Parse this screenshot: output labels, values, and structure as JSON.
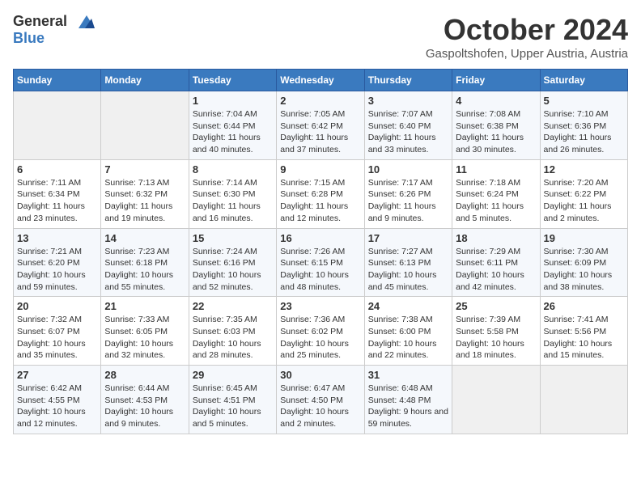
{
  "header": {
    "logo_general": "General",
    "logo_blue": "Blue",
    "month_title": "October 2024",
    "location": "Gaspoltshofen, Upper Austria, Austria"
  },
  "calendar": {
    "days_of_week": [
      "Sunday",
      "Monday",
      "Tuesday",
      "Wednesday",
      "Thursday",
      "Friday",
      "Saturday"
    ],
    "weeks": [
      [
        {
          "day": "",
          "info": ""
        },
        {
          "day": "",
          "info": ""
        },
        {
          "day": "1",
          "info": "Sunrise: 7:04 AM\nSunset: 6:44 PM\nDaylight: 11 hours and 40 minutes."
        },
        {
          "day": "2",
          "info": "Sunrise: 7:05 AM\nSunset: 6:42 PM\nDaylight: 11 hours and 37 minutes."
        },
        {
          "day": "3",
          "info": "Sunrise: 7:07 AM\nSunset: 6:40 PM\nDaylight: 11 hours and 33 minutes."
        },
        {
          "day": "4",
          "info": "Sunrise: 7:08 AM\nSunset: 6:38 PM\nDaylight: 11 hours and 30 minutes."
        },
        {
          "day": "5",
          "info": "Sunrise: 7:10 AM\nSunset: 6:36 PM\nDaylight: 11 hours and 26 minutes."
        }
      ],
      [
        {
          "day": "6",
          "info": "Sunrise: 7:11 AM\nSunset: 6:34 PM\nDaylight: 11 hours and 23 minutes."
        },
        {
          "day": "7",
          "info": "Sunrise: 7:13 AM\nSunset: 6:32 PM\nDaylight: 11 hours and 19 minutes."
        },
        {
          "day": "8",
          "info": "Sunrise: 7:14 AM\nSunset: 6:30 PM\nDaylight: 11 hours and 16 minutes."
        },
        {
          "day": "9",
          "info": "Sunrise: 7:15 AM\nSunset: 6:28 PM\nDaylight: 11 hours and 12 minutes."
        },
        {
          "day": "10",
          "info": "Sunrise: 7:17 AM\nSunset: 6:26 PM\nDaylight: 11 hours and 9 minutes."
        },
        {
          "day": "11",
          "info": "Sunrise: 7:18 AM\nSunset: 6:24 PM\nDaylight: 11 hours and 5 minutes."
        },
        {
          "day": "12",
          "info": "Sunrise: 7:20 AM\nSunset: 6:22 PM\nDaylight: 11 hours and 2 minutes."
        }
      ],
      [
        {
          "day": "13",
          "info": "Sunrise: 7:21 AM\nSunset: 6:20 PM\nDaylight: 10 hours and 59 minutes."
        },
        {
          "day": "14",
          "info": "Sunrise: 7:23 AM\nSunset: 6:18 PM\nDaylight: 10 hours and 55 minutes."
        },
        {
          "day": "15",
          "info": "Sunrise: 7:24 AM\nSunset: 6:16 PM\nDaylight: 10 hours and 52 minutes."
        },
        {
          "day": "16",
          "info": "Sunrise: 7:26 AM\nSunset: 6:15 PM\nDaylight: 10 hours and 48 minutes."
        },
        {
          "day": "17",
          "info": "Sunrise: 7:27 AM\nSunset: 6:13 PM\nDaylight: 10 hours and 45 minutes."
        },
        {
          "day": "18",
          "info": "Sunrise: 7:29 AM\nSunset: 6:11 PM\nDaylight: 10 hours and 42 minutes."
        },
        {
          "day": "19",
          "info": "Sunrise: 7:30 AM\nSunset: 6:09 PM\nDaylight: 10 hours and 38 minutes."
        }
      ],
      [
        {
          "day": "20",
          "info": "Sunrise: 7:32 AM\nSunset: 6:07 PM\nDaylight: 10 hours and 35 minutes."
        },
        {
          "day": "21",
          "info": "Sunrise: 7:33 AM\nSunset: 6:05 PM\nDaylight: 10 hours and 32 minutes."
        },
        {
          "day": "22",
          "info": "Sunrise: 7:35 AM\nSunset: 6:03 PM\nDaylight: 10 hours and 28 minutes."
        },
        {
          "day": "23",
          "info": "Sunrise: 7:36 AM\nSunset: 6:02 PM\nDaylight: 10 hours and 25 minutes."
        },
        {
          "day": "24",
          "info": "Sunrise: 7:38 AM\nSunset: 6:00 PM\nDaylight: 10 hours and 22 minutes."
        },
        {
          "day": "25",
          "info": "Sunrise: 7:39 AM\nSunset: 5:58 PM\nDaylight: 10 hours and 18 minutes."
        },
        {
          "day": "26",
          "info": "Sunrise: 7:41 AM\nSunset: 5:56 PM\nDaylight: 10 hours and 15 minutes."
        }
      ],
      [
        {
          "day": "27",
          "info": "Sunrise: 6:42 AM\nSunset: 4:55 PM\nDaylight: 10 hours and 12 minutes."
        },
        {
          "day": "28",
          "info": "Sunrise: 6:44 AM\nSunset: 4:53 PM\nDaylight: 10 hours and 9 minutes."
        },
        {
          "day": "29",
          "info": "Sunrise: 6:45 AM\nSunset: 4:51 PM\nDaylight: 10 hours and 5 minutes."
        },
        {
          "day": "30",
          "info": "Sunrise: 6:47 AM\nSunset: 4:50 PM\nDaylight: 10 hours and 2 minutes."
        },
        {
          "day": "31",
          "info": "Sunrise: 6:48 AM\nSunset: 4:48 PM\nDaylight: 9 hours and 59 minutes."
        },
        {
          "day": "",
          "info": ""
        },
        {
          "day": "",
          "info": ""
        }
      ]
    ]
  }
}
